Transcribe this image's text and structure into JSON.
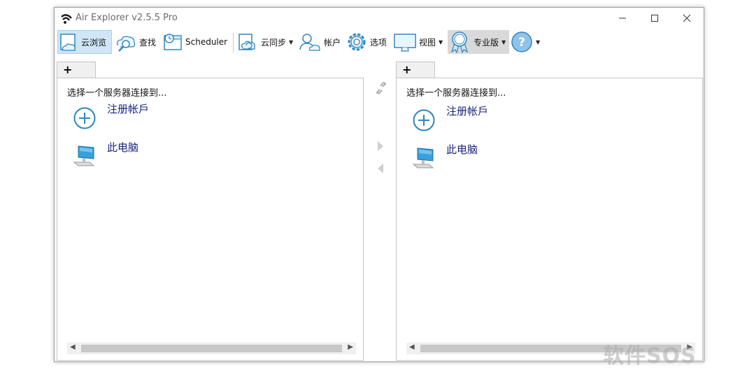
{
  "window": {
    "title": "Air Explorer v2.5.5 Pro"
  },
  "toolbar": {
    "cloud_browse": "云浏览",
    "search": "查找",
    "scheduler": "Scheduler",
    "cloud_sync": "云同步",
    "accounts": "帐户",
    "options": "选项",
    "view": "视图",
    "pro": "专业版"
  },
  "left_panel": {
    "tab_label": "+",
    "prompt": "选择一个服务器连接到...",
    "items": [
      {
        "label": "注册帐戶",
        "icon": "add-circle-icon"
      },
      {
        "label": "此电脑",
        "icon": "computer-icon"
      }
    ]
  },
  "right_panel": {
    "tab_label": "+",
    "prompt": "选择一个服务器连接到...",
    "items": [
      {
        "label": "注册帐戶",
        "icon": "add-circle-icon"
      },
      {
        "label": "此电脑",
        "icon": "computer-icon"
      }
    ]
  },
  "watermark": "软件SOS",
  "colors": {
    "accent": "#2e86c1",
    "active_bg": "#cfe6f7",
    "link_text": "#1a237e"
  }
}
